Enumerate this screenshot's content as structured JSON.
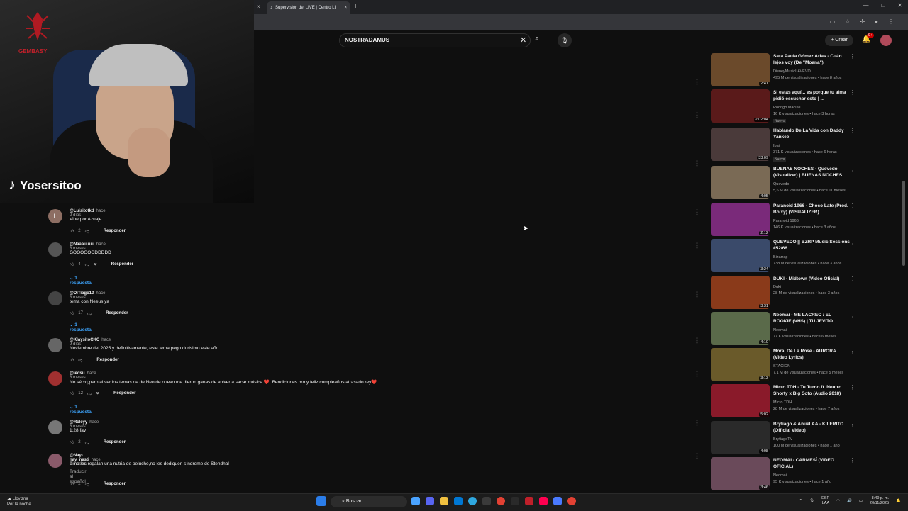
{
  "browser": {
    "tab_title": "Supervisión del LIVE | Centro LI",
    "new_tab": "+",
    "close": "×"
  },
  "youtube": {
    "search_value": "NOSTRADAMUS",
    "create_label": "Crear",
    "notif_count": "9+"
  },
  "stream": {
    "logo_text": "GEMBASY",
    "tiktok_name": "Yosersitoo"
  },
  "comments": [
    {
      "avatar": "L",
      "author": "@Luisitotkd",
      "time": "hace 2 días",
      "text": "Vine por Azuaje",
      "likes": "2",
      "reply": "Responder",
      "replies": ""
    },
    {
      "avatar": "",
      "author": "@Naaauuuu",
      "time": "hace 8 meses",
      "text": "GOOOOOODDDDD",
      "likes": "4",
      "reply": "Responder",
      "replies": "1 respuesta"
    },
    {
      "avatar": "",
      "author": "@DiTiago10",
      "time": "hace 8 meses",
      "text": "tema con Neeus ya",
      "likes": "17",
      "reply": "Responder",
      "replies": "1 respuesta"
    },
    {
      "avatar": "",
      "author": "@KlaysitoCKC",
      "time": "hace 9 días",
      "text": "Noviembre del 2025 y definitivamente, este tema pego durisimo este año",
      "likes": "",
      "reply": "Responder",
      "replies": ""
    },
    {
      "avatar": "",
      "author": "@ledsu",
      "time": "hace 8 meses",
      "text": "No sé xq,pero al ver los temas de de Neo de nuevo me dieron ganas de volver a sacar música ❤️. Bendiciones bro y feliz cumpleaños atrasado rey❤️",
      "likes": "12",
      "reply": "Responder",
      "replies": "1 respuesta"
    },
    {
      "avatar": "",
      "author": "@Rcleyy",
      "time": "hace 8 meses",
      "text": "1:28 fav",
      "likes": "2",
      "reply": "Responder",
      "replies": ""
    },
    {
      "avatar": "",
      "author": "@Nay-nay_nasti",
      "time": "hace 7 meses",
      "text": "si no les regalan una nutria de peluche,no les dediquen síndrome de Stendhal",
      "likes": "2",
      "reply": "Responder",
      "replies": "",
      "translate": "Traducir al español"
    }
  ],
  "sidebar": [
    {
      "title": "Sara Paula Gómez Arias - Cuán lejos voy (De \"Moana\")",
      "channel": "DisneyMusicLAVEVO",
      "meta": "495 M de visualizaciones • hace 8 años",
      "duration": "2:41",
      "color": "#6b4a2b",
      "new": ""
    },
    {
      "title": "Si estás aquí... es porque tu alma pidió escuchar esto | ...",
      "channel": "Rodrigo Macías",
      "meta": "16 K visualizaciones • hace 3 horas",
      "duration": "2:02:04",
      "color": "#5a1a1a",
      "new": "Nuevo"
    },
    {
      "title": "Hablando De La Vida con Daddy Yankee",
      "channel": "Ibai",
      "meta": "371 K visualizaciones • hace 6 horas",
      "duration": "33:09",
      "color": "#4a3a3a",
      "new": "Nuevo"
    },
    {
      "title": "BUENAS NOCHES - Quevedo (Visualizer) | BUENAS NOCHES",
      "channel": "Quevedo",
      "meta": "5,6 M de visualizaciones • hace 11 meses",
      "duration": "4:05",
      "color": "#7a6a55",
      "new": ""
    },
    {
      "title": "Paranoid 1966 - Choco Late (Prod. Boixy) (VISUALIZER)",
      "channel": "Paranoid 1966",
      "meta": "146 K visualizaciones • hace 3 años",
      "duration": "2:12",
      "color": "#7a2a7a",
      "new": ""
    },
    {
      "title": "QUEVEDO || BZRP Music Sessions #52/66",
      "channel": "Bizarrap",
      "meta": "738 M de visualizaciones • hace 3 años",
      "duration": "3:24",
      "color": "#3a4a6a",
      "new": ""
    },
    {
      "title": "DUKI - Midtown (Video Oficial)",
      "channel": "Duki",
      "meta": "28 M de visualizaciones • hace 3 años",
      "duration": "3:31",
      "color": "#8a3a1a",
      "new": ""
    },
    {
      "title": "Neomai - ME LACREO / EL ROOKIE (VHS) | TU JEVITO ...",
      "channel": "Neomai",
      "meta": "77 K visualizaciones • hace 6 meses",
      "duration": "4:10",
      "color": "#5a6a4a",
      "new": ""
    },
    {
      "title": "Mora, De La Rose - AURORA (Video Lyrics)",
      "channel": "STACION",
      "meta": "7,1 M de visualizaciones • hace 5 meses",
      "duration": "3:13",
      "color": "#6a5a2a",
      "new": ""
    },
    {
      "title": "Micro TDH - Tu Turno ft. Neutro Shorty x Big Soto (Audio 2018)",
      "channel": "Micro TDH",
      "meta": "28 M de visualizaciones • hace 7 años",
      "duration": "5:02",
      "color": "#8a1a2a",
      "new": ""
    },
    {
      "title": "Brytiago & Anuel AA - KILERITO (Official Video)",
      "channel": "BrytiagoTV",
      "meta": "100 M de visualizaciones • hace 1 año",
      "duration": "4:08",
      "color": "#2a2a2a",
      "new": ""
    },
    {
      "title": "NEOMAI - CARMESÍ (VIDEO OFICIAL)",
      "channel": "Neomai",
      "meta": "95 K visualizaciones • hace 1 año",
      "duration": "3:46",
      "color": "#6a4a5a",
      "new": ""
    }
  ],
  "taskbar": {
    "weather_1": "Llovizna",
    "weather_2": "Por la noche",
    "search_label": "Buscar",
    "lang_1": "ESP",
    "lang_2": "LAA",
    "time": "8:49 p. m.",
    "date": "20/11/2025"
  }
}
